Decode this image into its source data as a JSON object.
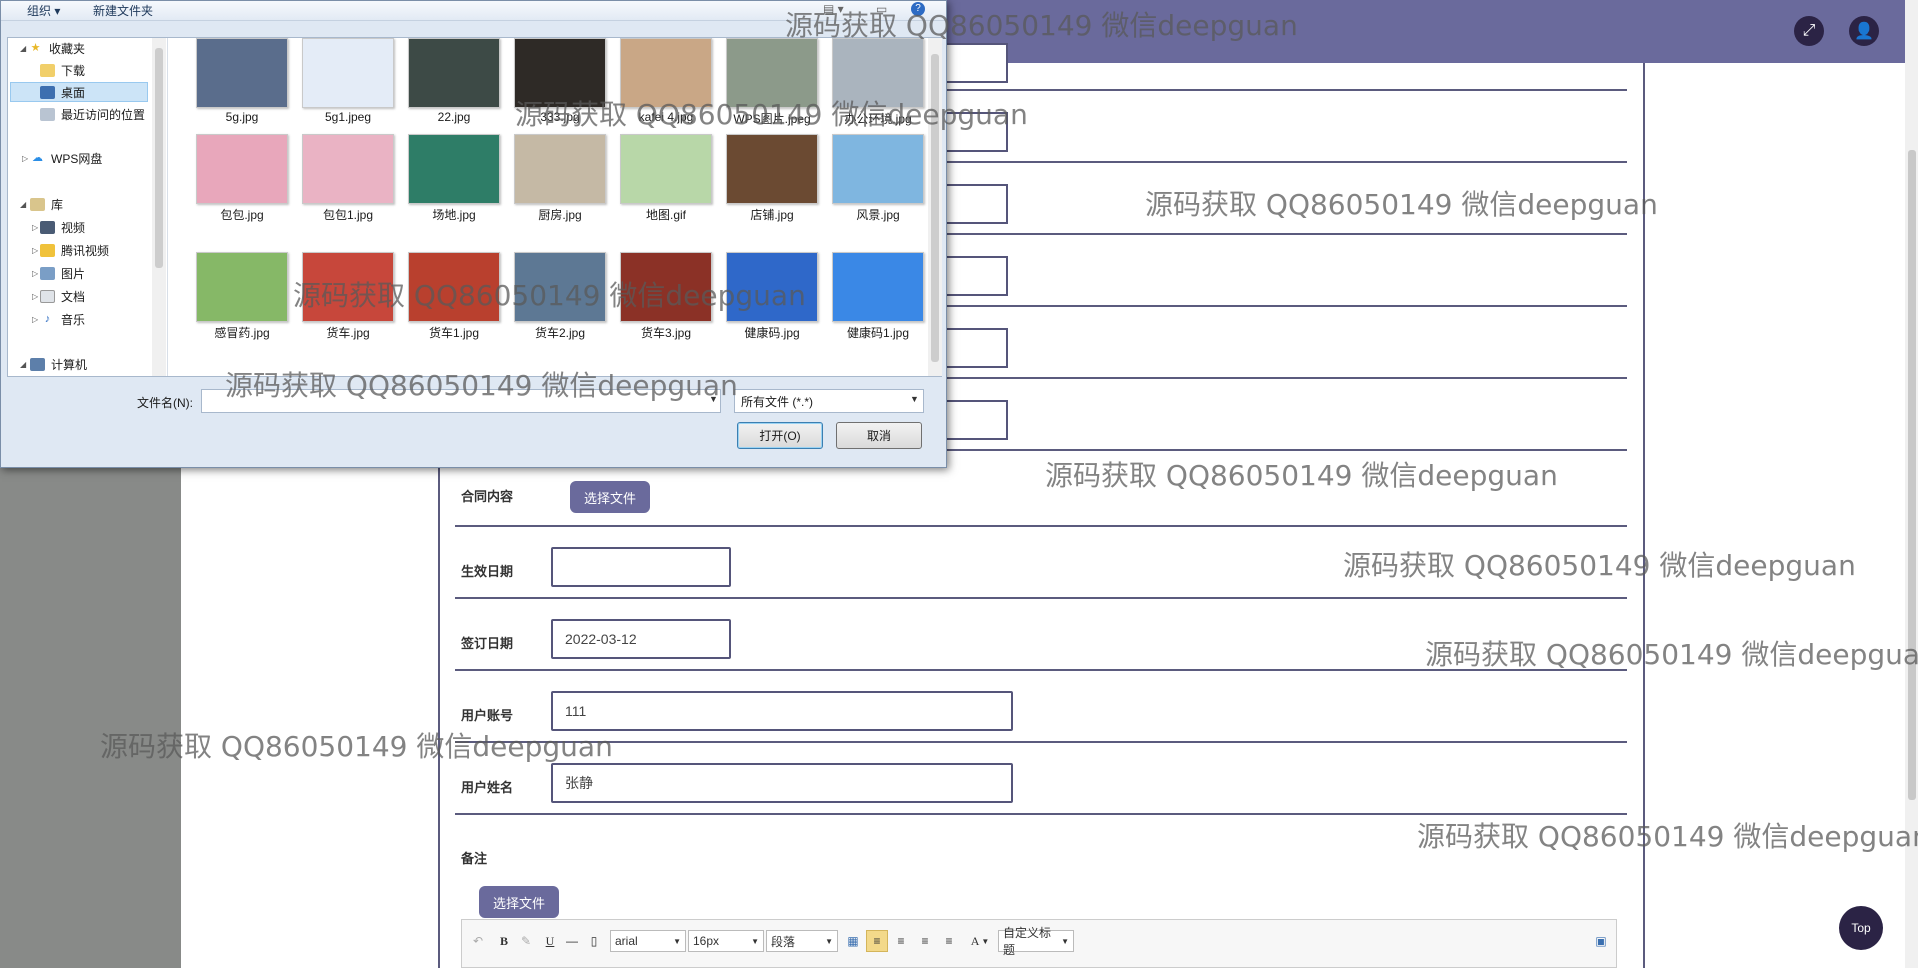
{
  "header": {
    "fullscreen_icon": "expand-icon",
    "user_icon": "user-icon",
    "bg_color": "#6a6a9c"
  },
  "form": {
    "contract_content": {
      "label": "合同内容",
      "button": "选择文件"
    },
    "effective_date": {
      "label": "生效日期",
      "value": ""
    },
    "sign_date": {
      "label": "签订日期",
      "value": "2022-03-12"
    },
    "user_account": {
      "label": "用户账号",
      "value": "111"
    },
    "user_name": {
      "label": "用户姓名",
      "value": "张静"
    },
    "remarks": {
      "label": "备注",
      "button": "选择文件"
    }
  },
  "editor": {
    "bold": "B",
    "italic": "I",
    "underline": "U",
    "strike": "—",
    "font_family": "arial",
    "font_size": "16px",
    "paragraph": "段落",
    "font_color": "A",
    "custom_heading": "自定义标题"
  },
  "top_button": "Top",
  "dialog": {
    "toolbar": {
      "organize": "组织 ▾",
      "new_folder": "新建文件夹",
      "help": "?"
    },
    "nav": {
      "favorites": "收藏夹",
      "downloads": "下载",
      "desktop": "桌面",
      "recent": "最近访问的位置",
      "wps_cloud": "WPS网盘",
      "libraries": "库",
      "videos": "视频",
      "tencent_video": "腾讯视频",
      "pictures": "图片",
      "documents": "文档",
      "music": "音乐",
      "computer": "计算机"
    },
    "files": [
      {
        "name": "5g.jpg",
        "color": "#5a6d8c"
      },
      {
        "name": "5g1.jpeg",
        "color": "#e4ecf7"
      },
      {
        "name": "22.jpg",
        "color": "#3d4a46"
      },
      {
        "name": "333.jpg",
        "color": "#2e2a26"
      },
      {
        "name": "kafei 4.jpg",
        "color": "#c9a786"
      },
      {
        "name": "WPS图片.jpeg",
        "color": "#8c9a8a"
      },
      {
        "name": "办公环境.jpg",
        "color": "#aab4be"
      },
      {
        "name": "包包.jpg",
        "color": "#e8a7bb"
      },
      {
        "name": "包包1.jpg",
        "color": "#eab3c4"
      },
      {
        "name": "场地.jpg",
        "color": "#2e7d67"
      },
      {
        "name": "厨房.jpg",
        "color": "#c5b9a5"
      },
      {
        "name": "地图.gif",
        "color": "#b8d7a8"
      },
      {
        "name": "店铺.jpg",
        "color": "#6b4a32"
      },
      {
        "name": "风景.jpg",
        "color": "#7fb6e0"
      },
      {
        "name": "感冒药.jpg",
        "color": "#86b867"
      },
      {
        "name": "货车.jpg",
        "color": "#c7473b"
      },
      {
        "name": "货车1.jpg",
        "color": "#b9402e"
      },
      {
        "name": "货车2.jpg",
        "color": "#5d7894"
      },
      {
        "name": "货车3.jpg",
        "color": "#8b3126"
      },
      {
        "name": "健康码.jpg",
        "color": "#2f68c9"
      },
      {
        "name": "健康码1.jpg",
        "color": "#3a88e6"
      }
    ],
    "filename_label": "文件名(N):",
    "filename_value": "",
    "filter": "所有文件 (*.*)",
    "open_button": "打开(O)",
    "cancel_button": "取消"
  },
  "watermark": "源码获取 QQ86050149 微信deepguan"
}
